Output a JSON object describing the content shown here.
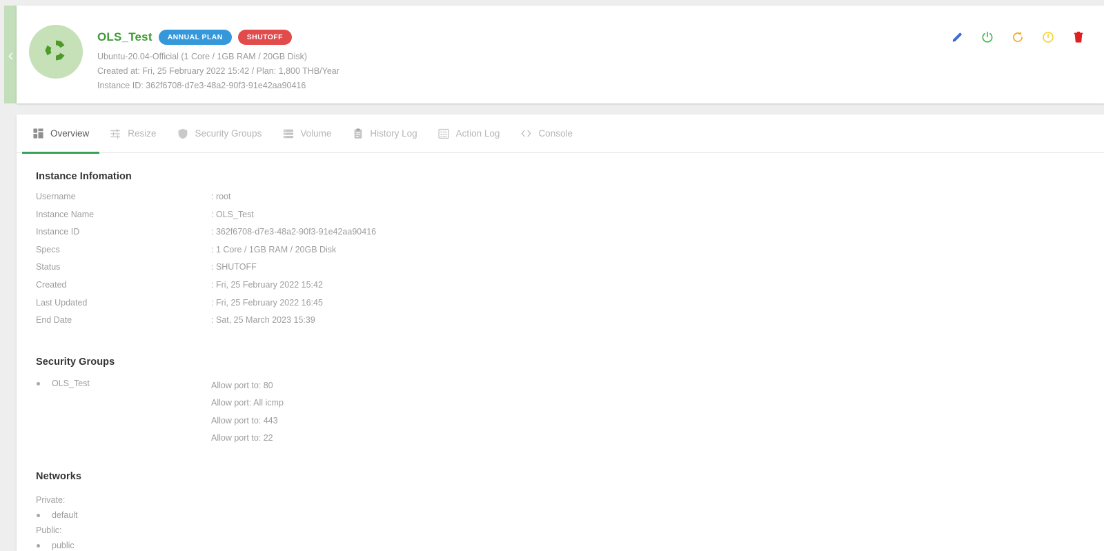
{
  "header": {
    "instance_name": "OLS_Test",
    "plan_badge": "ANNUAL PLAN",
    "status_badge": "SHUTOFF",
    "os_line": "Ubuntu-20.04-Official (1 Core / 1GB RAM / 20GB Disk)",
    "created_line": "Created at: Fri, 25 February 2022 15:42 / Plan: 1,800 THB/Year",
    "instance_id_line": "Instance ID: 362f6708-d7e3-48a2-90f3-91e42aa90416",
    "avatar_icon": "ubuntu-logo-icon",
    "collapse_icon": "chevron-left-icon",
    "actions": [
      {
        "name": "edit-instance-button",
        "icon": "pencil-icon",
        "color": "#3b6fd4"
      },
      {
        "name": "power-on-button",
        "icon": "power-icon",
        "color": "#39b54a"
      },
      {
        "name": "reboot-button",
        "icon": "refresh-icon",
        "color": "#f5a623"
      },
      {
        "name": "shutdown-button",
        "icon": "power-off-circle-icon",
        "color": "#f5d020"
      },
      {
        "name": "delete-instance-button",
        "icon": "trash-icon",
        "color": "#e02020"
      }
    ]
  },
  "tabs": [
    {
      "label": "Overview",
      "icon": "dashboard-icon",
      "active": true
    },
    {
      "label": "Resize",
      "icon": "sliders-icon",
      "active": false
    },
    {
      "label": "Security Groups",
      "icon": "shield-icon",
      "active": false
    },
    {
      "label": "Volume",
      "icon": "server-icon",
      "active": false
    },
    {
      "label": "History Log",
      "icon": "clipboard-icon",
      "active": false
    },
    {
      "label": "Action Log",
      "icon": "list-box-icon",
      "active": false
    },
    {
      "label": "Console",
      "icon": "code-icon",
      "active": false
    }
  ],
  "instance_information": {
    "title": "Instance Infomation",
    "rows": [
      {
        "key": "Username",
        "value": ": root"
      },
      {
        "key": "Instance Name",
        "value": ": OLS_Test"
      },
      {
        "key": "Instance ID",
        "value": ": 362f6708-d7e3-48a2-90f3-91e42aa90416"
      },
      {
        "key": "Specs",
        "value": ": 1 Core / 1GB RAM / 20GB Disk"
      },
      {
        "key": "Status",
        "value": ": SHUTOFF"
      },
      {
        "key": "Created",
        "value": ": Fri, 25 February 2022 15:42"
      },
      {
        "key": "Last Updated",
        "value": ": Fri, 25 February 2022 16:45"
      },
      {
        "key": "End Date",
        "value": ": Sat, 25 March 2023 15:39"
      }
    ]
  },
  "security_groups": {
    "title": "Security Groups",
    "groups": [
      {
        "name": "OLS_Test",
        "rules": [
          "Allow port to: 80",
          "Allow port: All icmp",
          "Allow port to: 443",
          "Allow port to: 22"
        ]
      }
    ]
  },
  "networks": {
    "title": "Networks",
    "private_label": "Private:",
    "private_items": [
      "default"
    ],
    "public_label": "Public:",
    "public_items": [
      "public"
    ]
  },
  "colors": {
    "brand_green": "#3f9b35",
    "accent_tab_underline": "#37a05c",
    "badge_plan": "#3498db",
    "badge_status": "#e14b4b",
    "rail": "#c3debb",
    "avatar_bg": "#c6e0b8",
    "muted_text": "#9d9d9d"
  }
}
